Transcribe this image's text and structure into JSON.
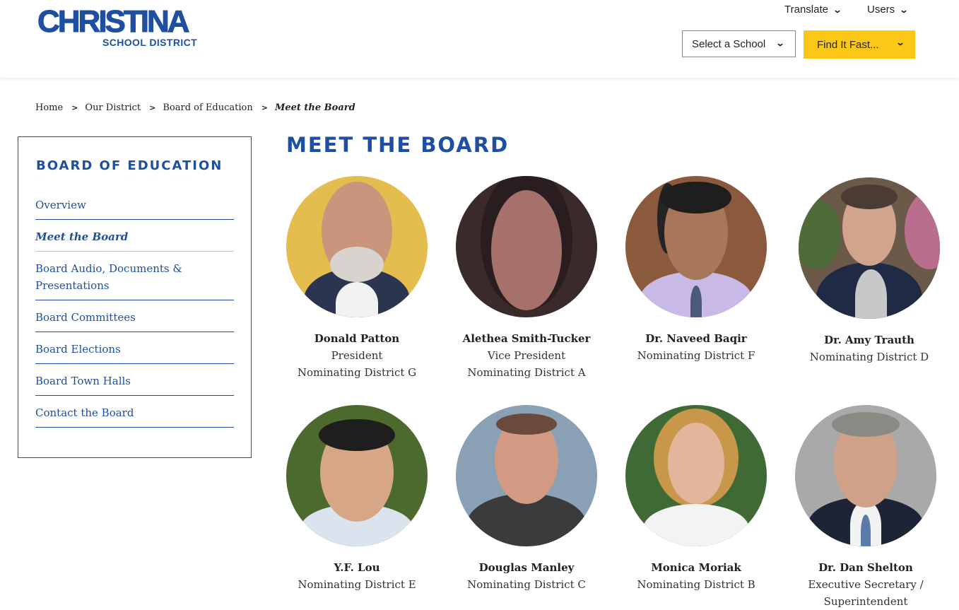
{
  "header": {
    "logo_big": "CHRISTINA",
    "logo_small": "SCHOOL DISTRICT",
    "translate_label": "Translate",
    "users_label": "Users",
    "select_school_label": "Select a School",
    "find_it_fast_label": "Find It Fast...",
    "accent_color": "#fcc817",
    "brand_color": "#1f4fa0"
  },
  "breadcrumb": {
    "items": [
      "Home",
      "Our District",
      "Board of Education"
    ],
    "current": "Meet the Board"
  },
  "sidebar": {
    "title": "BOARD OF EDUCATION",
    "items": [
      {
        "label": "Overview"
      },
      {
        "label": "Meet the Board"
      },
      {
        "label": "Board Audio, Documents & Presentations"
      },
      {
        "label": "Board Committees"
      },
      {
        "label": "Board Elections"
      },
      {
        "label": "Board Town Halls"
      },
      {
        "label": "Contact the Board"
      }
    ]
  },
  "main": {
    "title": "MEET THE BOARD",
    "members": [
      {
        "name": "Donald Patton",
        "role1": "President",
        "role2": "Nominating District G"
      },
      {
        "name": "Alethea Smith-Tucker",
        "role1": "Vice President",
        "role2": "Nominating District A"
      },
      {
        "name": "Dr. Naveed Baqir",
        "role1": "Nominating District F",
        "role2": ""
      },
      {
        "name": "Dr. Amy Trauth",
        "role1": "Nominating District D",
        "role2": ""
      },
      {
        "name": "Y.F. Lou",
        "role1": "Nominating District E",
        "role2": ""
      },
      {
        "name": "Douglas Manley",
        "role1": "Nominating District C",
        "role2": ""
      },
      {
        "name": "Monica Moriak",
        "role1": "Nominating District B",
        "role2": ""
      },
      {
        "name": "Dr. Dan Shelton",
        "role1": "Executive Secretary /",
        "role2": "Superintendent"
      }
    ]
  }
}
